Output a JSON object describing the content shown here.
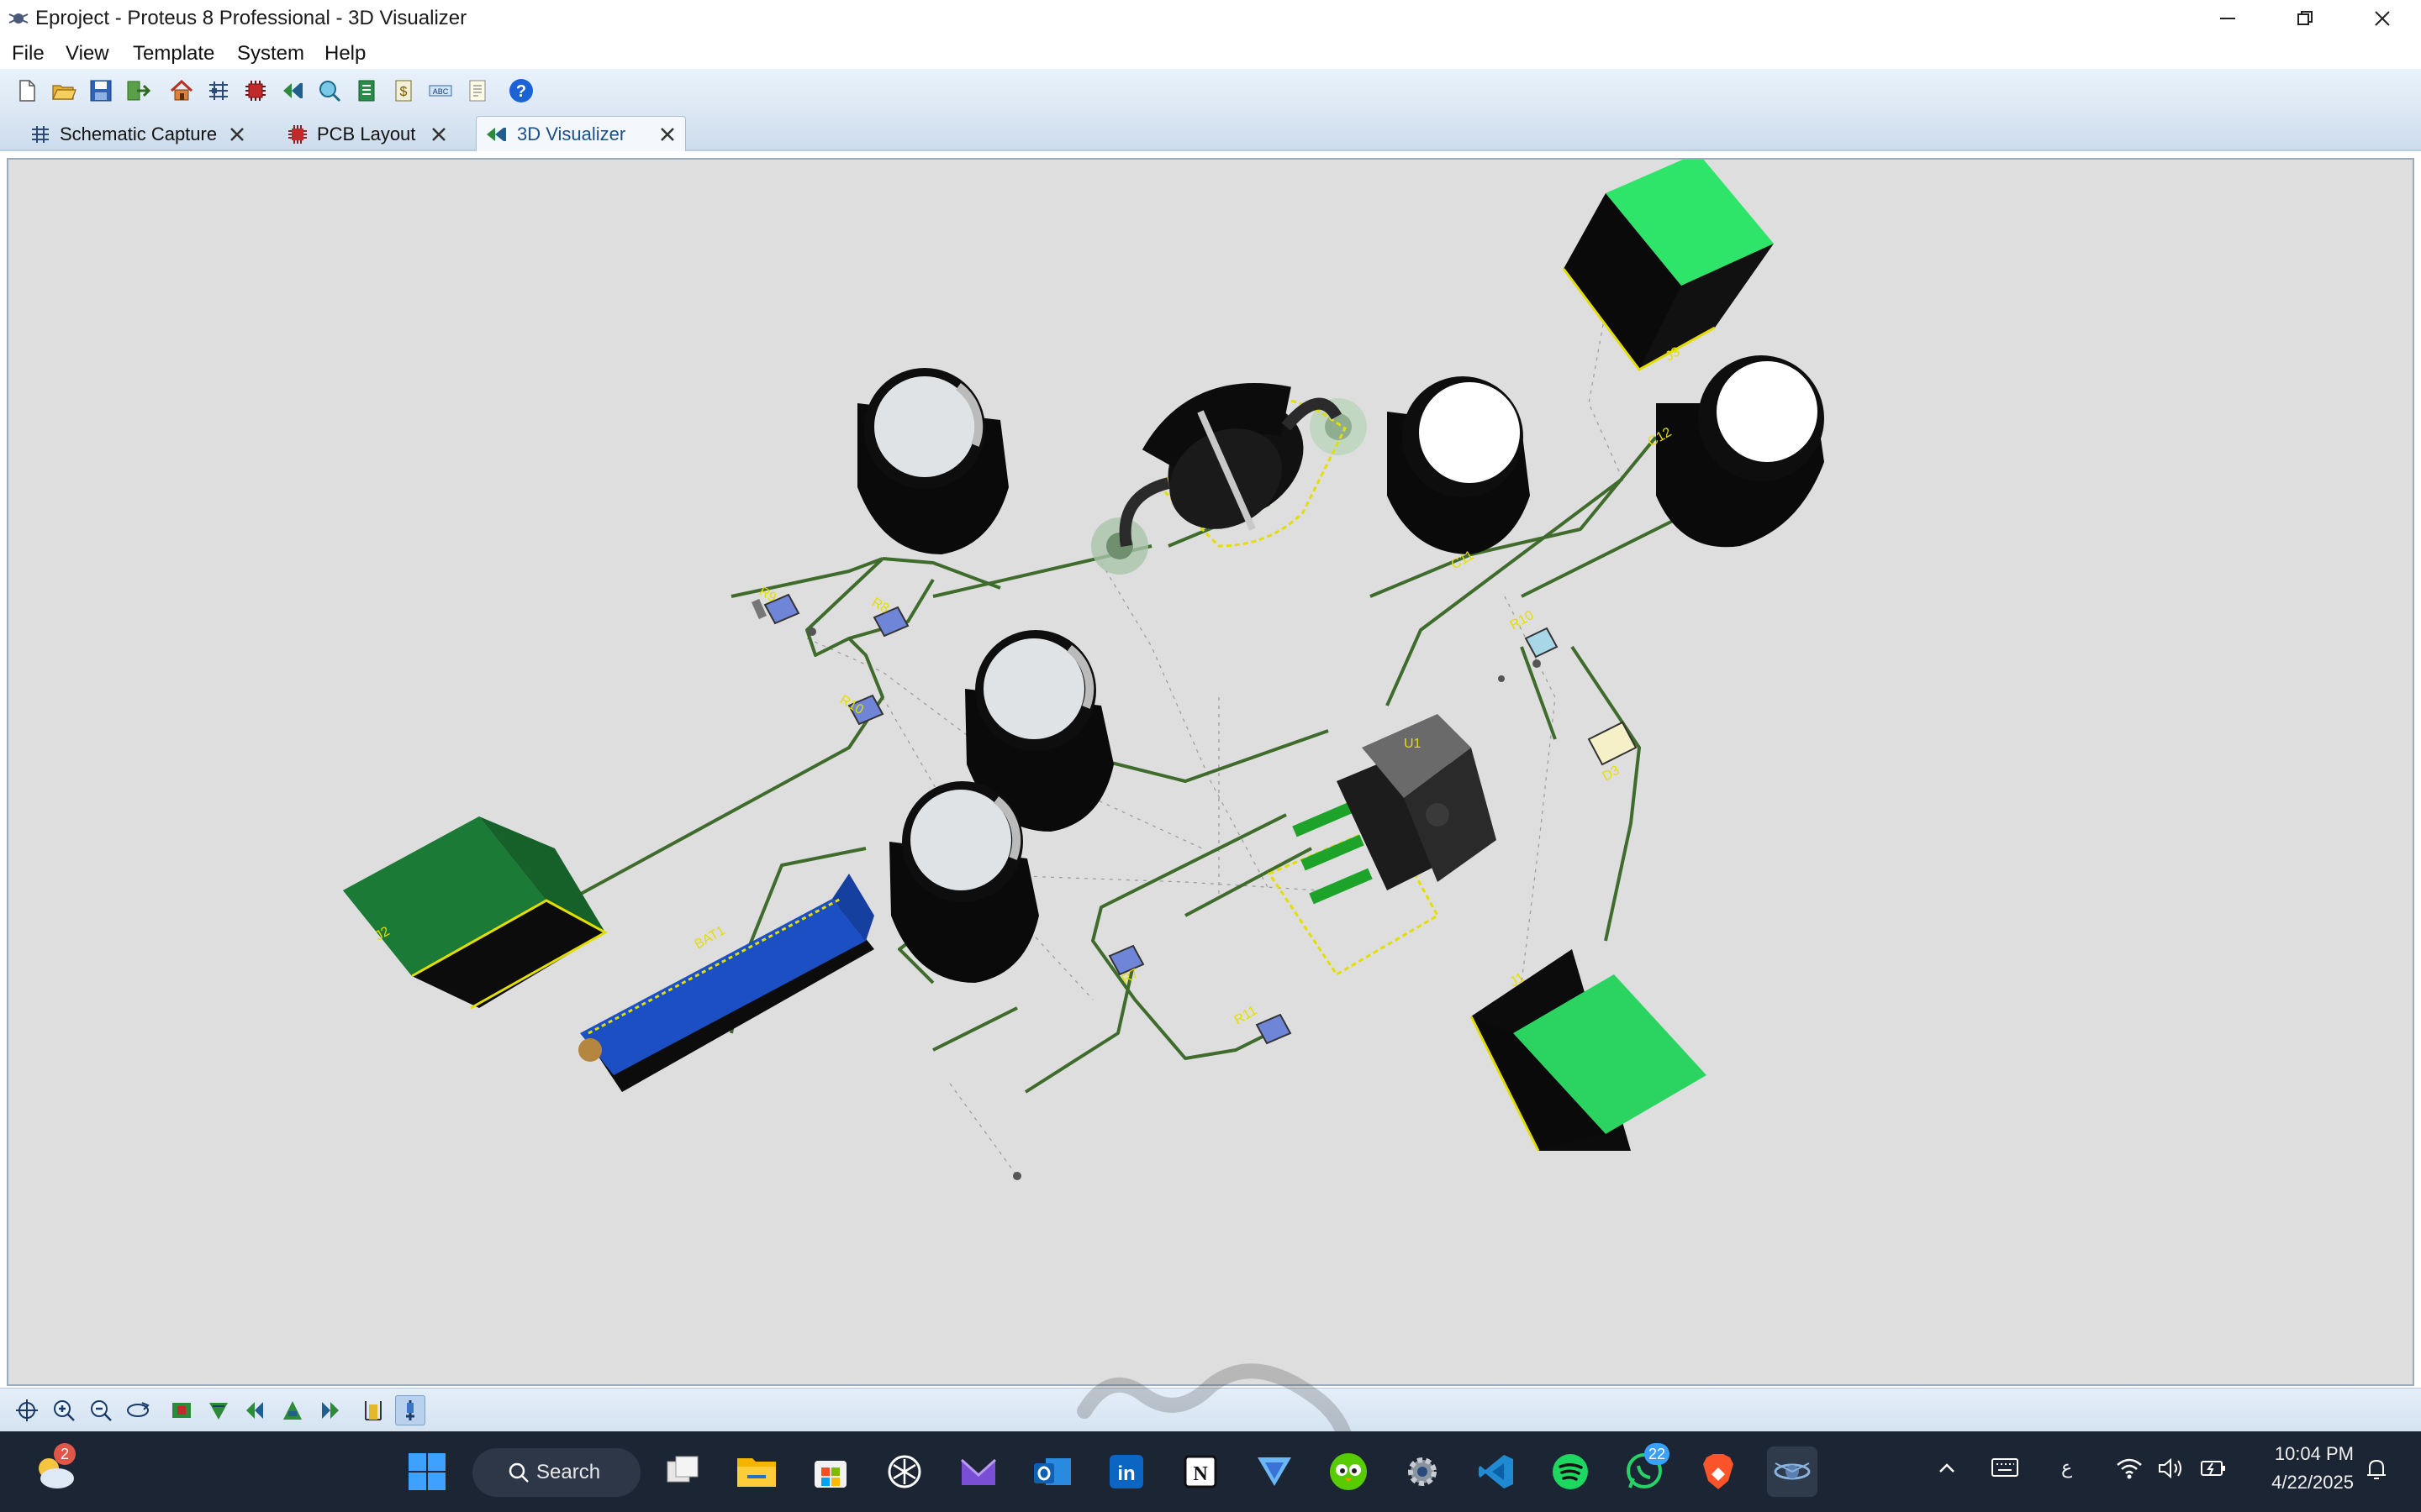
{
  "window": {
    "title": "Eproject - Proteus 8 Professional - 3D Visualizer",
    "controls": [
      "minimize",
      "restore",
      "close"
    ]
  },
  "menu": [
    "File",
    "View",
    "Template",
    "System",
    "Help"
  ],
  "toolbar_icons": [
    "new-file-icon",
    "open-folder-icon",
    "save-icon",
    "import-icon",
    "home-icon",
    "schematic-icon",
    "pcb-icon",
    "3d-visualizer-icon",
    "gerber-icon",
    "bom-icon",
    "bill-cost-icon",
    "design-explorer-icon",
    "notes-icon",
    "help-icon"
  ],
  "tabs": [
    {
      "label": "Schematic Capture",
      "icon": "schematic-icon",
      "active": false
    },
    {
      "label": "PCB Layout",
      "icon": "pcb-chip-icon",
      "active": false
    },
    {
      "label": "3D Visualizer",
      "icon": "3d-visualizer-icon",
      "active": true
    }
  ],
  "scene": {
    "background": "#dedede",
    "component_labels": {
      "r9": "R9",
      "r8": "R8",
      "r10": "R10",
      "r7": "R7",
      "r11": "R11",
      "r10b": "R10",
      "d3": "D3",
      "j3": "J3",
      "j1": "J1",
      "c11": "C11",
      "c12": "C12",
      "u1": "U1",
      "bat": "BAT1",
      "j2": "J2"
    }
  },
  "view_tools": [
    "pan-center-icon",
    "zoom-in-icon",
    "zoom-out-icon",
    "rotate-icon",
    "top-view-icon",
    "bottom-view-icon",
    "left-view-icon",
    "front-view-icon",
    "right-view-icon",
    "height-icon",
    "component-height-icon"
  ],
  "taskbar": {
    "weather_badge": "2",
    "search_label": "Search",
    "apps": [
      "task-view-icon",
      "file-explorer-icon",
      "microsoft-store-icon",
      "chatgpt-icon",
      "mail-icon",
      "outlook-icon",
      "linkedin-icon",
      "notion-icon",
      "vpn-icon",
      "duolingo-icon",
      "settings-icon",
      "vscode-icon",
      "spotify-icon",
      "whatsapp-icon",
      "brave-icon",
      "proteus-icon"
    ],
    "whatsapp_badge": "22",
    "tray": {
      "language": "ع",
      "time": "10:04 PM",
      "date": "4/22/2025"
    }
  },
  "colors": {
    "pcb_board": "#dedede",
    "trace": "#3f6b2c",
    "silkscreen": "#e8e000",
    "connector_green": "#1b7a35",
    "battery_blue": "#1d4fc4"
  }
}
